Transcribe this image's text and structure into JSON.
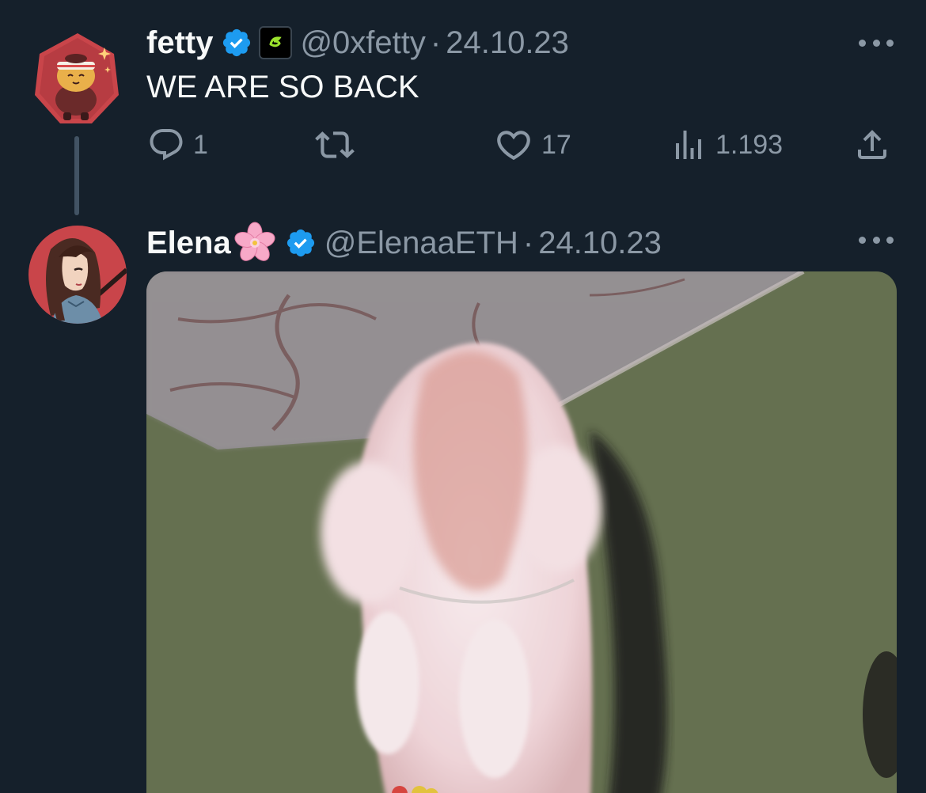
{
  "tweets": [
    {
      "display_name": "fetty",
      "handle": "@0xfetty",
      "date": "24.10.23",
      "text": "WE ARE SO BACK",
      "reply_count": "1",
      "like_count": "17",
      "view_count": "1.193"
    },
    {
      "display_name": "Elena",
      "handle": "@ElenaaETH",
      "date": "24.10.23"
    }
  ],
  "separator": "·",
  "colors": {
    "background": "#15202b",
    "primary_text": "#f7f9f9",
    "secondary_text": "#8b98a5",
    "verified_blue": "#1d9bf0",
    "thread_line": "#425364"
  },
  "icons": {
    "verified": "verified-badge-icon",
    "affiliate": "affiliate-badge-icon",
    "flower": "cherry-blossom-emoji",
    "reply": "reply-icon",
    "retweet": "retweet-icon",
    "like": "heart-icon",
    "views": "views-chart-icon",
    "share": "share-icon",
    "more": "more-dots-icon"
  }
}
